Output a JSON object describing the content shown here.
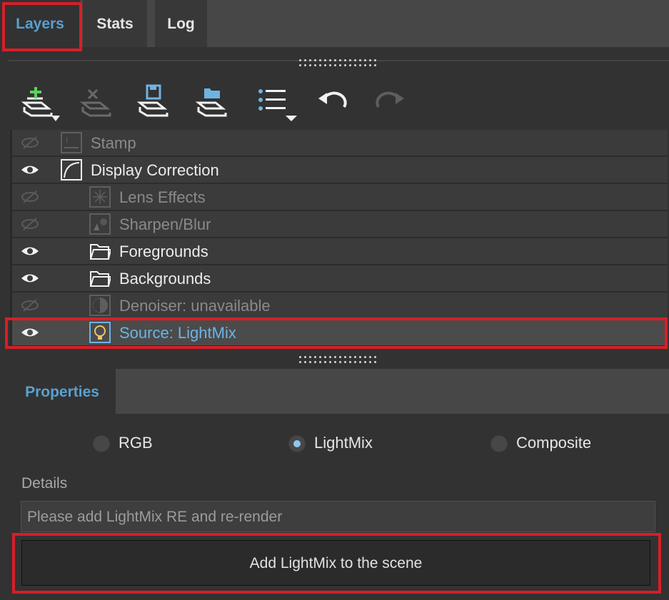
{
  "tabs": [
    {
      "label": "Layers",
      "active": true
    },
    {
      "label": "Stats",
      "active": false
    },
    {
      "label": "Log",
      "active": false
    }
  ],
  "toolbar": {
    "add_layer_icon": "add-layer-icon",
    "remove_layer_icon": "remove-layer-icon",
    "save_layers_icon": "save-layers-icon",
    "load_layers_icon": "load-layers-icon",
    "list_menu_icon": "list-menu-icon",
    "undo_icon": "undo-icon",
    "redo_icon": "redo-icon"
  },
  "layers": [
    {
      "name": "Stamp",
      "visible": false,
      "icon": "stamp-icon",
      "indent": 0,
      "enabled": false
    },
    {
      "name": "Display Correction",
      "visible": true,
      "icon": "curve-icon",
      "indent": 0,
      "enabled": true
    },
    {
      "name": "Lens Effects",
      "visible": false,
      "icon": "lens-effects-icon",
      "indent": 1,
      "enabled": false
    },
    {
      "name": "Sharpen/Blur",
      "visible": false,
      "icon": "sharpen-blur-icon",
      "indent": 1,
      "enabled": false
    },
    {
      "name": "Foregrounds",
      "visible": true,
      "icon": "folder-icon",
      "indent": 1,
      "enabled": true
    },
    {
      "name": "Backgrounds",
      "visible": true,
      "icon": "folder-icon",
      "indent": 1,
      "enabled": true
    },
    {
      "name": "Denoiser: unavailable",
      "visible": false,
      "icon": "denoiser-icon",
      "indent": 1,
      "enabled": false
    },
    {
      "name": "Source: LightMix",
      "visible": true,
      "icon": "lightbulb-icon",
      "indent": 1,
      "enabled": true,
      "selected": true
    }
  ],
  "properties": {
    "tab_label": "Properties",
    "radios": [
      {
        "label": "RGB",
        "checked": false
      },
      {
        "label": "LightMix",
        "checked": true
      },
      {
        "label": "Composite",
        "checked": false
      }
    ],
    "details_label": "Details",
    "details_text": "Please add LightMix RE and re-render",
    "action_button": "Add LightMix to the scene"
  },
  "colors": {
    "accent": "#5aa0cf",
    "highlight_box": "#d81e27",
    "background": "#323232"
  }
}
